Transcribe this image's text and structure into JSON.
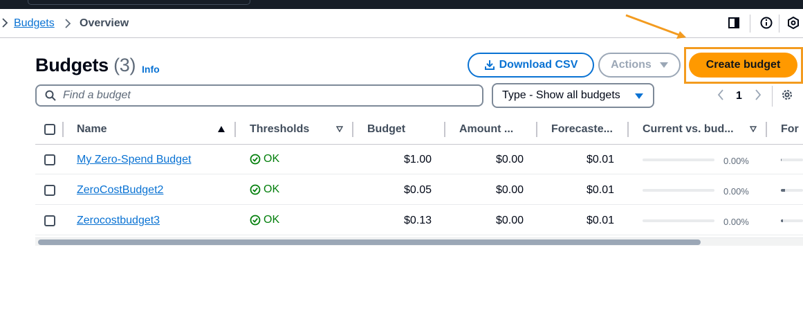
{
  "breadcrumb": {
    "link_label": "Budgets",
    "current": "Overview"
  },
  "header": {
    "title": "Budgets",
    "count": "(3)",
    "info_label": "Info"
  },
  "actions": {
    "download_label": "Download CSV",
    "actions_label": "Actions",
    "create_label": "Create budget"
  },
  "filter": {
    "search_placeholder": "Find a budget",
    "type_select_value": "Type - Show all budgets"
  },
  "pagination": {
    "current_page": "1"
  },
  "table": {
    "columns": [
      {
        "label": "Name",
        "sort": "ascending"
      },
      {
        "label": "Thresholds",
        "sort": "sortable"
      },
      {
        "label": "Budget",
        "sort": "none"
      },
      {
        "label": "Amount ...",
        "sort": "none"
      },
      {
        "label": "Forecaste...",
        "sort": "none"
      },
      {
        "label": "Current vs. bud...",
        "sort": "sortable"
      },
      {
        "label": "For",
        "sort": "none"
      }
    ],
    "rows": [
      {
        "name": "My Zero-Spend Budget",
        "threshold": "OK",
        "budget": "$1.00",
        "amount": "$0.00",
        "forecasted": "$0.01",
        "current_vs_budget": "0.00%",
        "current_vs_budget_fraction": 0.0,
        "forecast_fraction": 0.03
      },
      {
        "name": "ZeroCostBudget2",
        "threshold": "OK",
        "budget": "$0.05",
        "amount": "$0.00",
        "forecasted": "$0.01",
        "current_vs_budget": "0.00%",
        "current_vs_budget_fraction": 0.0,
        "forecast_fraction": 0.2
      },
      {
        "name": "Zerocostbudget3",
        "threshold": "OK",
        "budget": "$0.13",
        "amount": "$0.00",
        "forecasted": "$0.01",
        "current_vs_budget": "0.00%",
        "current_vs_budget_fraction": 0.0,
        "forecast_fraction": 0.08
      }
    ]
  },
  "colors": {
    "link": "#0972d3",
    "primary_button": "#ff9900",
    "highlight_annotation": "#f39b1f",
    "ok_status": "#037f0c",
    "topbar": "#161d26"
  },
  "icons": [
    "chevron-right-icon",
    "panel-icon",
    "info-icon",
    "cloudshell-icon",
    "download-icon",
    "caret-down-icon",
    "search-icon",
    "chevron-left-icon",
    "settings-icon",
    "status-ok-icon",
    "sort-ascending-icon",
    "sort-icon"
  ]
}
